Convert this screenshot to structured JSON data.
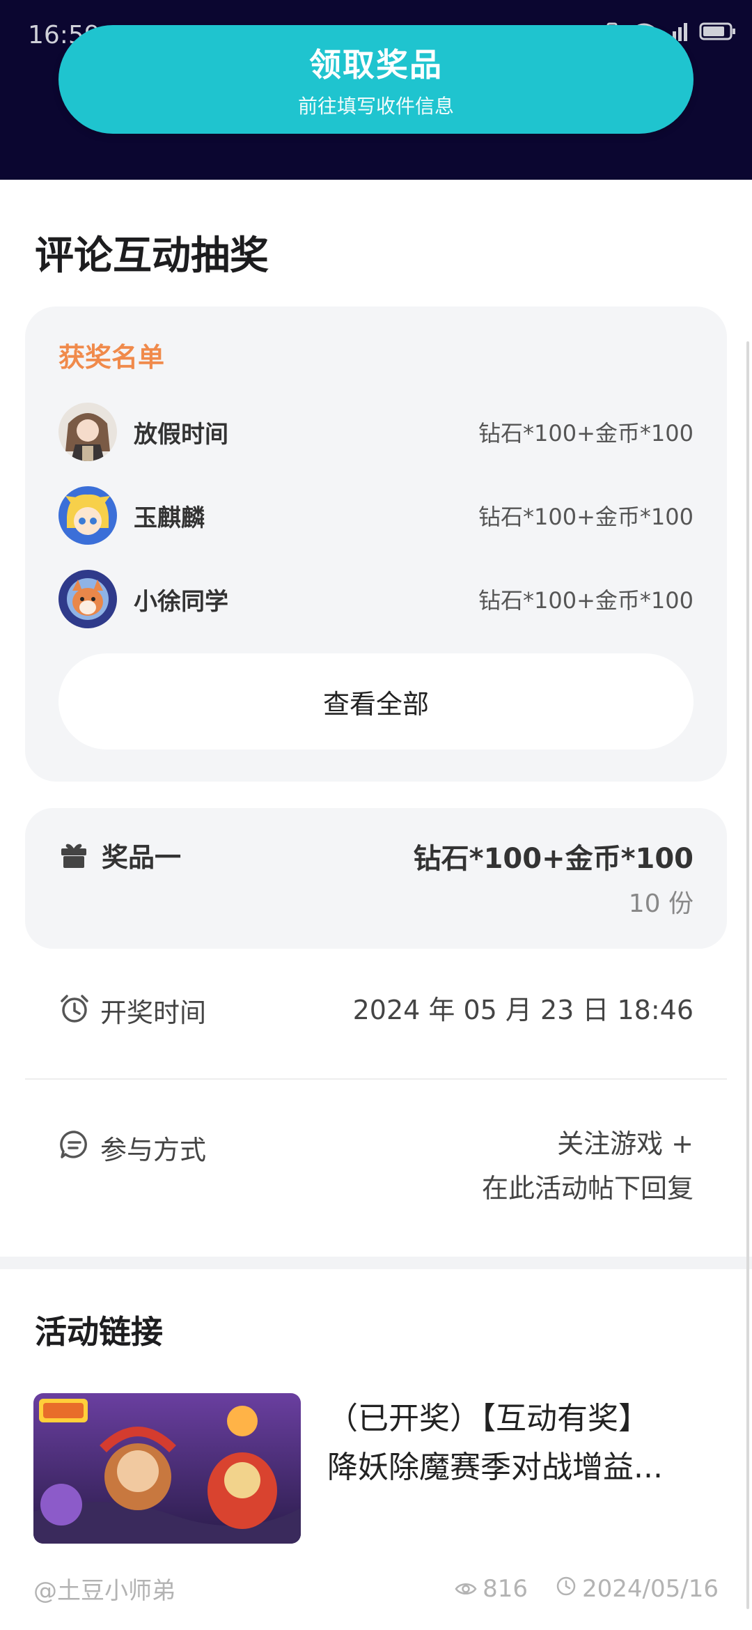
{
  "status_bar": {
    "time": "16:59"
  },
  "claim_button": {
    "title": "领取奖品",
    "subtitle": "前往填写收件信息"
  },
  "page_title": "评论互动抽奖",
  "winners": {
    "title": "获奖名单",
    "items": [
      {
        "name": "放假时间",
        "prize": "钻石*100+金币*100"
      },
      {
        "name": "玉麒麟",
        "prize": "钻石*100+金币*100"
      },
      {
        "name": "小徐同学",
        "prize": "钻石*100+金币*100"
      }
    ],
    "view_all": "查看全部"
  },
  "prize": {
    "label": "奖品一",
    "value": "钻石*100+金币*100",
    "count": "10 份"
  },
  "draw_time": {
    "label": "开奖时间",
    "value": "2024 年 05 月 23 日 18:46"
  },
  "participation": {
    "label": "参与方式",
    "line1": "关注游戏 +",
    "line2": "在此活动帖下回复"
  },
  "activity_link": {
    "section_title": "活动链接",
    "title_line1": "（已开奖）【互动有奖】",
    "title_line2": "降妖除魔赛季对战增益...",
    "author": "@土豆小师弟",
    "views": "816",
    "date": "2024/05/16"
  },
  "colors": {
    "accent": "#1fc4cf",
    "banner": "#0b0630",
    "winners_title": "#f08a4b"
  }
}
